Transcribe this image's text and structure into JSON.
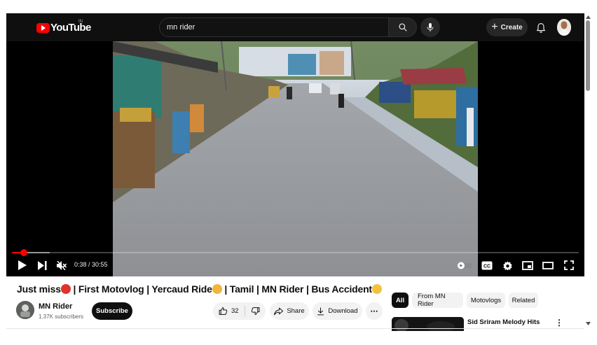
{
  "header": {
    "logo_text": "YouTube",
    "logo_region": "IN",
    "search_value": "mn rider",
    "create_label": "Create"
  },
  "player": {
    "time_display": "0:38 / 30:55",
    "progress_fraction": 0.0205,
    "buffer_fraction": 0.067
  },
  "video": {
    "title_part1": "Just miss",
    "title_part2": " | First Motovlog | Yercaud Ride",
    "title_part3": " | Tamil | MN Rider | Bus Accident",
    "channel_name": "MN Rider",
    "subscribers": "1.37K subscribers",
    "subscribe_label": "Subscribe",
    "like_count": "32",
    "share_label": "Share",
    "download_label": "Download",
    "more_label": "⋯"
  },
  "chips": [
    "All",
    "From MN Rider",
    "Motovlogs",
    "Related"
  ],
  "recommendation": {
    "title": "Sid Sriram Melody Hits"
  },
  "colors": {
    "brand_red": "#ff0000",
    "dark": "#0f0f0f"
  }
}
